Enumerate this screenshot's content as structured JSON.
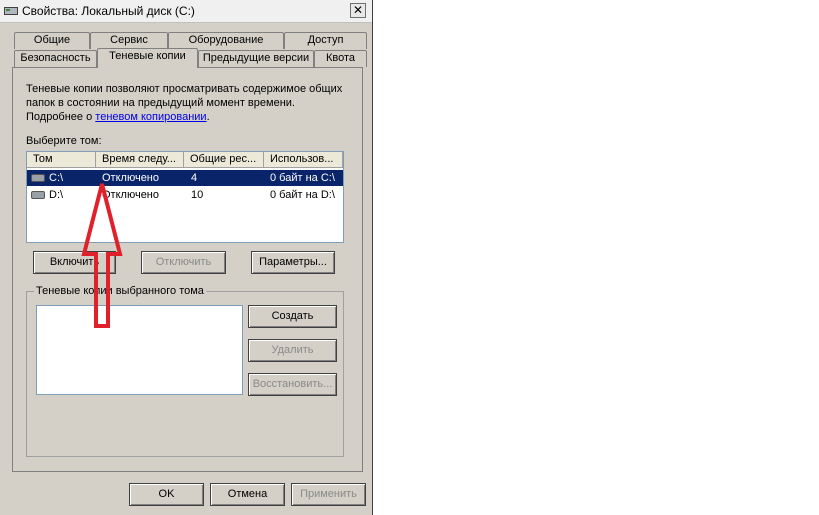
{
  "window": {
    "title": "Свойства: Локальный диск (C:)",
    "close_glyph": "✕"
  },
  "tabs_row1": [
    {
      "label": "Общие"
    },
    {
      "label": "Сервис"
    },
    {
      "label": "Оборудование"
    },
    {
      "label": "Доступ"
    }
  ],
  "tabs_row2": [
    {
      "label": "Безопасность"
    },
    {
      "label": "Теневые копии",
      "active": true
    },
    {
      "label": "Предыдущие версии"
    },
    {
      "label": "Квота"
    }
  ],
  "description": {
    "text": "Теневые копии позволяют просматривать содержимое общих папок в состоянии на предыдущий момент времени.",
    "more_prefix": "Подробнее о ",
    "more_link": "теневом копировании",
    "more_suffix": "."
  },
  "volumes": {
    "label": "Выберите том:",
    "columns": [
      "Том",
      "Время следу...",
      "Общие рес...",
      "Использов..."
    ],
    "rows": [
      {
        "volume": "C:\\",
        "next_run": "Отключено",
        "shares": "4",
        "used": "0 байт на C:\\",
        "selected": true
      },
      {
        "volume": "D:\\",
        "next_run": "Отключено",
        "shares": "10",
        "used": "0 байт на D:\\",
        "selected": false
      }
    ]
  },
  "volume_buttons": {
    "enable": "Включить",
    "disable": "Отключить",
    "settings": "Параметры..."
  },
  "shadow_copies": {
    "label": "Теневые копии выбранного тома",
    "create": "Создать",
    "delete": "Удалить",
    "restore": "Восстановить..."
  },
  "footer": {
    "ok": "OK",
    "cancel": "Отмена",
    "apply": "Применить"
  },
  "colors": {
    "selection": "#0a246a",
    "arrow": "#e0202a",
    "link": "#0000ee"
  }
}
